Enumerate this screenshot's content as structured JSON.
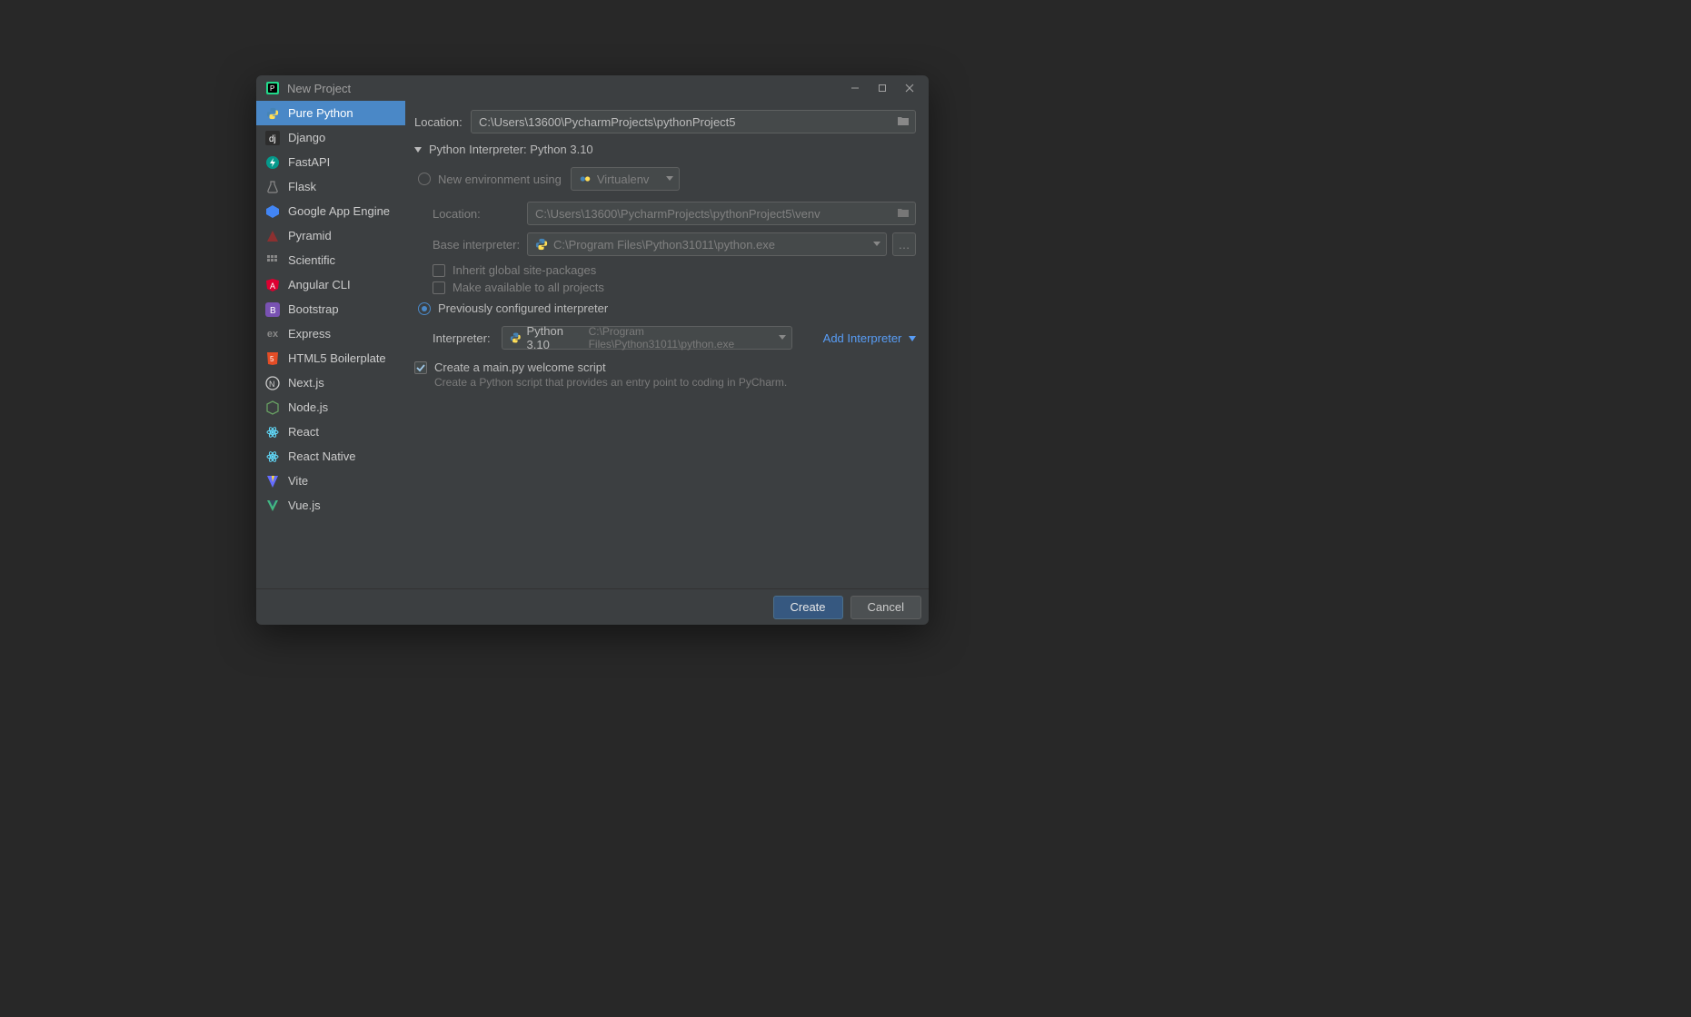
{
  "titlebar": {
    "title": "New Project"
  },
  "sidebar": {
    "items": [
      {
        "label": "Pure Python"
      },
      {
        "label": "Django"
      },
      {
        "label": "FastAPI"
      },
      {
        "label": "Flask"
      },
      {
        "label": "Google App Engine"
      },
      {
        "label": "Pyramid"
      },
      {
        "label": "Scientific"
      },
      {
        "label": "Angular CLI"
      },
      {
        "label": "Bootstrap"
      },
      {
        "label": "Express"
      },
      {
        "label": "HTML5 Boilerplate"
      },
      {
        "label": "Next.js"
      },
      {
        "label": "Node.js"
      },
      {
        "label": "React"
      },
      {
        "label": "React Native"
      },
      {
        "label": "Vite"
      },
      {
        "label": "Vue.js"
      }
    ],
    "selected_index": 0
  },
  "main": {
    "location_label": "Location:",
    "location_value": "C:\\Users\\13600\\PycharmProjects\\pythonProject5",
    "interp_header": "Python Interpreter: Python 3.10",
    "new_env_label": "New environment using",
    "new_env_tool": "Virtualenv",
    "env_location_label": "Location:",
    "env_location_value": "C:\\Users\\13600\\PycharmProjects\\pythonProject5\\venv",
    "base_interp_label": "Base interpreter:",
    "base_interp_value": "C:\\Program Files\\Python31011\\python.exe",
    "inherit_label": "Inherit global site-packages",
    "make_avail_label": "Make available to all projects",
    "prev_conf_label": "Previously configured interpreter",
    "interp_label": "Interpreter:",
    "interp_name": "Python 3.10",
    "interp_path": "C:\\Program Files\\Python31011\\python.exe",
    "add_interp": "Add Interpreter",
    "welcome_label": "Create a main.py welcome script",
    "welcome_hint": "Create a Python script that provides an entry point to coding in PyCharm.",
    "selected_radio": "prev",
    "welcome_checked": true
  },
  "footer": {
    "create": "Create",
    "cancel": "Cancel"
  }
}
